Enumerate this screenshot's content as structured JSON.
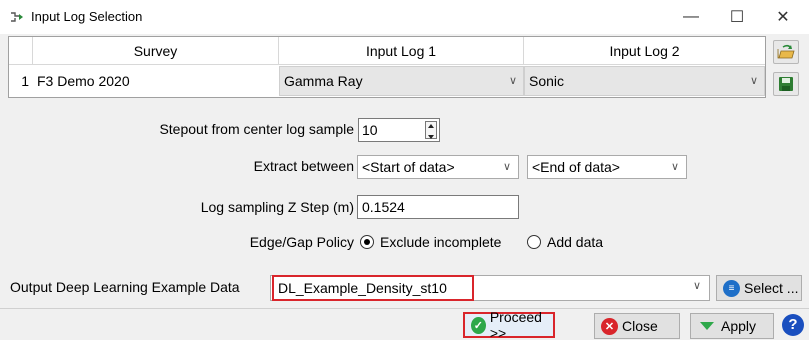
{
  "window": {
    "title": "Input Log Selection",
    "minimize_glyph": "—",
    "maximize_glyph": "☐",
    "close_glyph": "✕"
  },
  "table": {
    "headers": [
      "Survey",
      "Input Log 1",
      "Input Log 2"
    ],
    "rows": [
      {
        "num": "1",
        "survey": "F3 Demo 2020",
        "log1": "Gamma Ray",
        "log2": "Sonic"
      }
    ],
    "combo_arrow": "∨"
  },
  "form": {
    "stepout_label": "Stepout from center log sample",
    "stepout_value": "10",
    "extract_label": "Extract between",
    "extract_start": "<Start of data>",
    "extract_end": "<End of data>",
    "zstep_label": "Log sampling Z Step (m)",
    "zstep_value": "0.1524",
    "edge_label": "Edge/Gap Policy",
    "edge_options": [
      "Exclude incomplete",
      "Add data"
    ],
    "edge_selected": "Exclude incomplete",
    "output_label": "Output Deep Learning Example Data",
    "output_value": "DL_Example_Density_st10",
    "select_label": "Select ..."
  },
  "buttons": {
    "proceed": "Proceed >>",
    "close": "Close",
    "apply": "Apply",
    "help_glyph": "?"
  },
  "colors": {
    "highlight": "#d9252b",
    "proceed_icon": "#2ea84a",
    "close_icon": "#d9252b",
    "apply_icon": "#2ea84a",
    "help": "#1a4fbf",
    "select_icon": "#1e6fc8"
  }
}
